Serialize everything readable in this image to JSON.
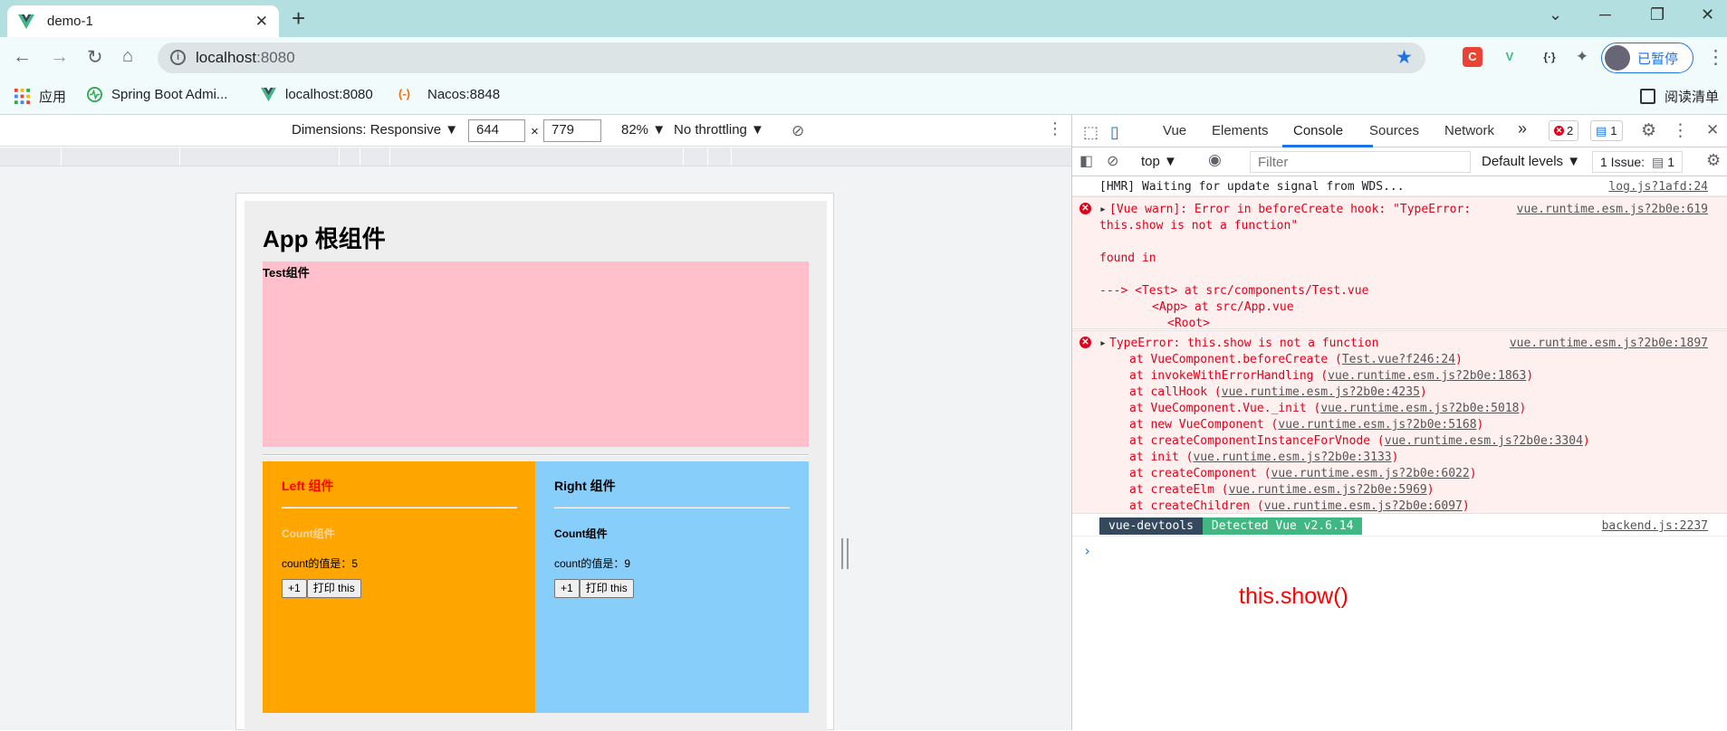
{
  "browser": {
    "tab_title": "demo-1",
    "new_tab": "+",
    "tab_close": "✕",
    "url_host": "localhost",
    "url_port": ":8080",
    "profile_label": "已暂停",
    "window": {
      "minimize": "─",
      "maximize": "❐",
      "close": "✕",
      "dropdown": "⌄"
    },
    "extensions": [
      {
        "name": "c-ext-icon",
        "glyph": "C",
        "color": "#ea4335"
      },
      {
        "name": "vue-devtools-icon",
        "glyph": "V",
        "color": "#41b883"
      },
      {
        "name": "json-ext-icon",
        "glyph": "{·}",
        "color": "#333333"
      },
      {
        "name": "puzzle-icon",
        "glyph": "✦",
        "color": "#5f6368"
      }
    ]
  },
  "bookmarks": {
    "apps_label": "应用",
    "items": [
      "Spring Boot Admi...",
      "localhost:8080",
      "Nacos:8848"
    ],
    "reading_list": "阅读清单"
  },
  "device_toolbar": {
    "dimensions_label": "Dimensions: Responsive ▼",
    "width": "644",
    "times": "×",
    "height": "779",
    "zoom": "82% ▼",
    "throttle": "No throttling ▼"
  },
  "app": {
    "title": "App 根组件",
    "test_label": "Test组件",
    "left": {
      "title": "Left 组件",
      "count_title": "Count组件",
      "count_text": "count的值是：5",
      "btn_inc": "+1",
      "btn_print": "打印 this"
    },
    "right": {
      "title": "Right 组件",
      "count_title": "Count组件",
      "count_text": "count的值是：9",
      "btn_inc": "+1",
      "btn_print": "打印 this"
    }
  },
  "devtools": {
    "tabs": [
      "Vue",
      "Elements",
      "Console",
      "Sources",
      "Network"
    ],
    "active_tab": "Console",
    "more": "»",
    "errors_count": "2",
    "messages_count": "1",
    "context": "top ▼",
    "filter_placeholder": "Filter",
    "levels": "Default levels ▼",
    "issues_label": "1 Issue:",
    "issues_count": "1",
    "console": {
      "hmr": "[HMR] Waiting for update signal from WDS...",
      "hmr_src": "log.js?1afd:24",
      "warn_line1": "[Vue warn]: Error in beforeCreate hook: \"TypeError:",
      "warn_line2": "this.show is not a function\"",
      "warn_src": "vue.runtime.esm.js?2b0e:619",
      "found_in": "found in",
      "tree1": "---> <Test> at src/components/Test.vue",
      "tree2": "<App> at src/App.vue",
      "tree3": "<Root>",
      "type_error": "TypeError: this.show is not a function",
      "type_error_src": "vue.runtime.esm.js?2b0e:1897",
      "stack": [
        {
          "fn": "at VueComponent.beforeCreate (",
          "file": "Test.vue?f246:24",
          "end": ")"
        },
        {
          "fn": "at invokeWithErrorHandling (",
          "file": "vue.runtime.esm.js?2b0e:1863",
          "end": ")"
        },
        {
          "fn": "at callHook (",
          "file": "vue.runtime.esm.js?2b0e:4235",
          "end": ")"
        },
        {
          "fn": "at VueComponent.Vue._init (",
          "file": "vue.runtime.esm.js?2b0e:5018",
          "end": ")"
        },
        {
          "fn": "at new VueComponent (",
          "file": "vue.runtime.esm.js?2b0e:5168",
          "end": ")"
        },
        {
          "fn": "at createComponentInstanceForVnode (",
          "file": "vue.runtime.esm.js?2b0e:3304",
          "end": ")"
        },
        {
          "fn": "at init (",
          "file": "vue.runtime.esm.js?2b0e:3133",
          "end": ")"
        },
        {
          "fn": "at createComponent (",
          "file": "vue.runtime.esm.js?2b0e:6022",
          "end": ")"
        },
        {
          "fn": "at createElm (",
          "file": "vue.runtime.esm.js?2b0e:5969",
          "end": ")"
        },
        {
          "fn": "at createChildren (",
          "file": "vue.runtime.esm.js?2b0e:6097",
          "end": ")"
        }
      ],
      "devtools_tag": "vue-devtools",
      "detected_tag": "Detected Vue v2.6.14",
      "backend_src": "backend.js:2237",
      "prompt": "›"
    }
  },
  "annotation": "this.show()"
}
